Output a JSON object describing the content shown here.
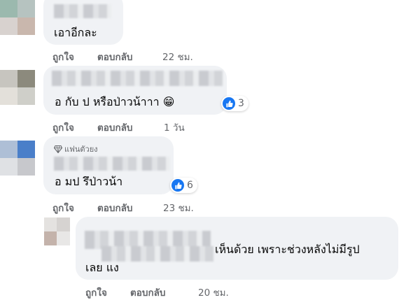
{
  "comments": [
    {
      "text": "เอาอีกละ",
      "actions": {
        "like": "ถูกใจ",
        "reply": "ตอบกลับ",
        "time": "22 ชม."
      }
    },
    {
      "text": "อ กับ ป หรือป่าวน้าาา",
      "emoji": "😁",
      "reaction": {
        "icon": "like-icon",
        "count": "3"
      },
      "actions": {
        "like": "ถูกใจ",
        "reply": "ตอบกลับ",
        "time": "1 วัน"
      }
    },
    {
      "badge": {
        "icon": "diamond-icon",
        "label": "แฟนตัวยง"
      },
      "text": "อ มป รึป่าวน้า",
      "reaction": {
        "icon": "like-icon",
        "count": "6"
      },
      "actions": {
        "like": "ถูกใจ",
        "reply": "ตอบกลับ",
        "time": "23 ชม."
      }
    },
    {
      "text_line1": "เห็นด้วย เพราะช่วงหลังไม่มีรูป",
      "text_line2": "เลย แง",
      "actions": {
        "like": "ถูกใจ",
        "reply": "ตอบกลับ",
        "time": "20 ชม."
      }
    }
  ],
  "colors": {
    "bubble": "#f0f2f5",
    "like_blue": "#1877f2",
    "meta_gray": "#65676b"
  }
}
